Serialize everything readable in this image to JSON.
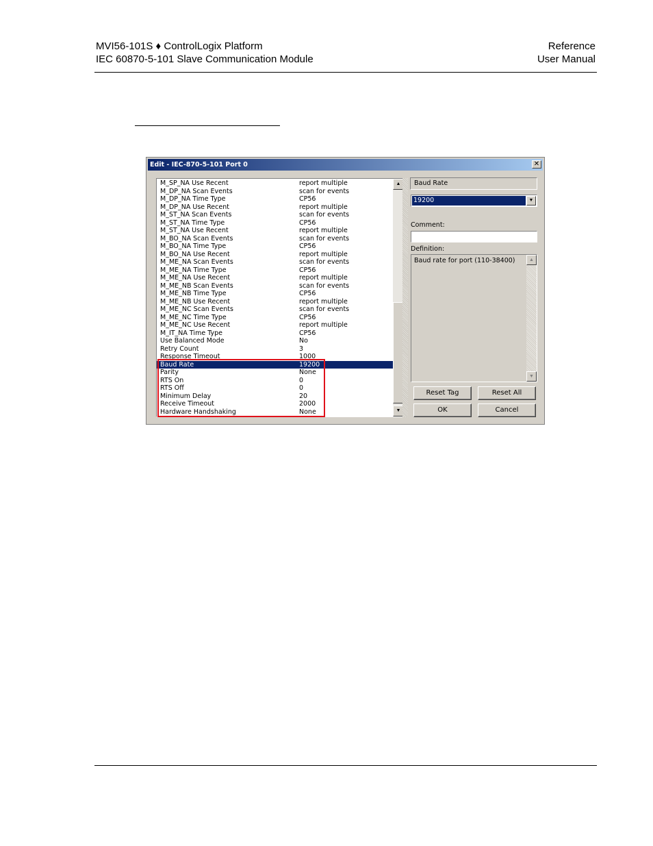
{
  "header": {
    "left_line1": "MVI56-101S ♦ ControlLogix Platform",
    "left_line2": "IEC 60870-5-101 Slave Communication Module",
    "right_line1": "Reference",
    "right_line2": "User Manual"
  },
  "dialog": {
    "title": "Edit - IEC-870-5-101 Port 0",
    "close_glyph": "✕",
    "rows": [
      {
        "name": "M_SP_NA Use Recent",
        "value": "report multiple"
      },
      {
        "name": "M_DP_NA Scan Events",
        "value": "scan for events"
      },
      {
        "name": "M_DP_NA Time Type",
        "value": "CP56"
      },
      {
        "name": "M_DP_NA Use Recent",
        "value": "report multiple"
      },
      {
        "name": "M_ST_NA Scan Events",
        "value": "scan for events"
      },
      {
        "name": "M_ST_NA Time Type",
        "value": "CP56"
      },
      {
        "name": "M_ST_NA Use Recent",
        "value": "report multiple"
      },
      {
        "name": "M_BO_NA Scan Events",
        "value": "scan for events"
      },
      {
        "name": "M_BO_NA Time Type",
        "value": "CP56"
      },
      {
        "name": "M_BO_NA Use Recent",
        "value": "report multiple"
      },
      {
        "name": "M_ME_NA Scan Events",
        "value": "scan for events"
      },
      {
        "name": "M_ME_NA Time Type",
        "value": "CP56"
      },
      {
        "name": "M_ME_NA Use Recent",
        "value": "report multiple"
      },
      {
        "name": "M_ME_NB Scan Events",
        "value": "scan for events"
      },
      {
        "name": "M_ME_NB Time Type",
        "value": "CP56"
      },
      {
        "name": "M_ME_NB Use Recent",
        "value": "report multiple"
      },
      {
        "name": "M_ME_NC Scan Events",
        "value": "scan for events"
      },
      {
        "name": "M_ME_NC Time Type",
        "value": "CP56"
      },
      {
        "name": "M_ME_NC Use Recent",
        "value": "report multiple"
      },
      {
        "name": "M_IT_NA Time Type",
        "value": "CP56"
      },
      {
        "name": "Use Balanced Mode",
        "value": "No"
      },
      {
        "name": "Retry Count",
        "value": "3"
      },
      {
        "name": "Response Timeout",
        "value": "1000"
      },
      {
        "name": "Baud Rate",
        "value": "19200",
        "selected": true
      },
      {
        "name": "Parity",
        "value": "None"
      },
      {
        "name": "RTS On",
        "value": "0"
      },
      {
        "name": "RTS Off",
        "value": "0"
      },
      {
        "name": "Minimum Delay",
        "value": "20"
      },
      {
        "name": "Receive Timeout",
        "value": "2000"
      },
      {
        "name": "Hardware Handshaking",
        "value": "None"
      }
    ],
    "scroll_up_glyph": "▲",
    "scroll_down_glyph": "▼",
    "selected_tag": "Baud Rate",
    "selected_value": "19200",
    "combo_arrow": "▼",
    "comment_label": "Comment:",
    "comment_value": "",
    "definition_label": "Definition:",
    "definition_text": "Baud rate for port (110-38400)",
    "buttons": {
      "reset_tag": "Reset Tag",
      "reset_all": "Reset All",
      "ok": "OK",
      "cancel": "Cancel"
    },
    "highlight_color": "#e0111a",
    "selection_color": "#0a246a"
  }
}
